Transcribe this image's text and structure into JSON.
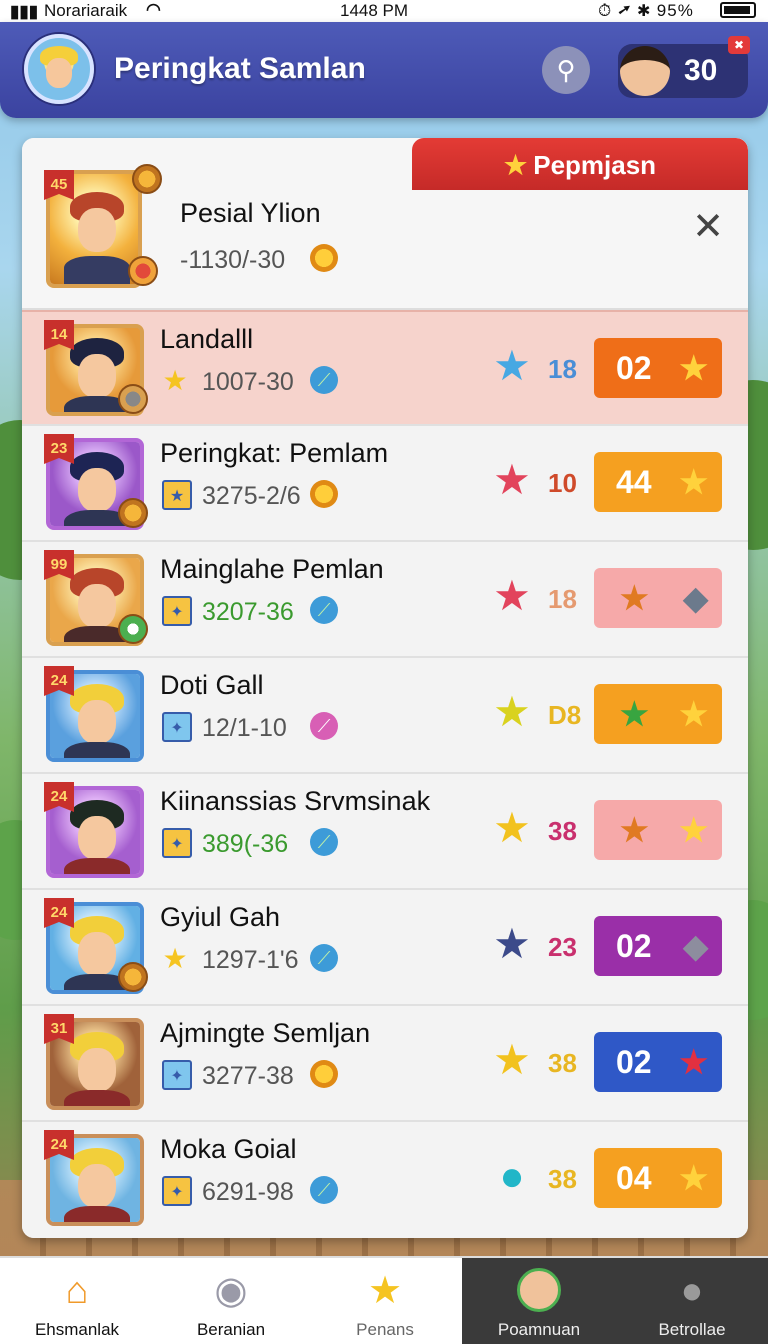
{
  "status_bar": {
    "carrier": "Norariaraik",
    "time": "1448 PM",
    "system": "⏱ ➚ ✱ 95%"
  },
  "header": {
    "title": "Peringkat Samlan",
    "badge_count": "30"
  },
  "ribbon": {
    "label": "Pepmjasn"
  },
  "player": {
    "rank": "45",
    "name": "Pesial Ylion",
    "score": "-1130/-30"
  },
  "rows": [
    {
      "rank": "14",
      "name": "Landalll",
      "score": "1007-30",
      "stat": "18",
      "reward": "02",
      "highlight": true
    },
    {
      "rank": "23",
      "name": "Peringkat: Pemlam",
      "score": "3275-2/6",
      "stat": "10",
      "reward": "44"
    },
    {
      "rank": "99",
      "name": "Mainglahe Pemlan",
      "score": "3207-36",
      "stat": "18",
      "reward": ""
    },
    {
      "rank": "24",
      "name": "Doti Gall",
      "score": "12/1-10",
      "stat": "D8",
      "reward": ""
    },
    {
      "rank": "24",
      "name": "Kiinanssias Srvmsinak",
      "score": "389(-36",
      "stat": "38",
      "reward": ""
    },
    {
      "rank": "24",
      "name": "Gyiul Gah",
      "score": "1297-1'6",
      "stat": "23",
      "reward": "02"
    },
    {
      "rank": "31",
      "name": "Ajmingte Semljan",
      "score": "3277-38",
      "stat": "38",
      "reward": "02"
    },
    {
      "rank": "24",
      "name": "Moka Goial",
      "score": "6291-98",
      "stat": "38",
      "reward": "04"
    }
  ],
  "nav": [
    {
      "label": "Ehsmanlak",
      "icon": "home-icon"
    },
    {
      "label": "Beranian",
      "icon": "dog-icon"
    },
    {
      "label": "Penans",
      "icon": "star-icon"
    },
    {
      "label": "Poamnuan",
      "icon": "avatar-icon"
    },
    {
      "label": "Betrollae",
      "icon": "person-icon"
    }
  ],
  "colors": {
    "header_bg": "#4e5bb8",
    "ribbon_red": "#e43b35",
    "reward_orange": "#f5a020",
    "reward_deep_orange": "#ef6e18",
    "reward_pink": "#f6a9a9",
    "reward_purple": "#9a2fa8",
    "reward_blue": "#2f58c7"
  }
}
